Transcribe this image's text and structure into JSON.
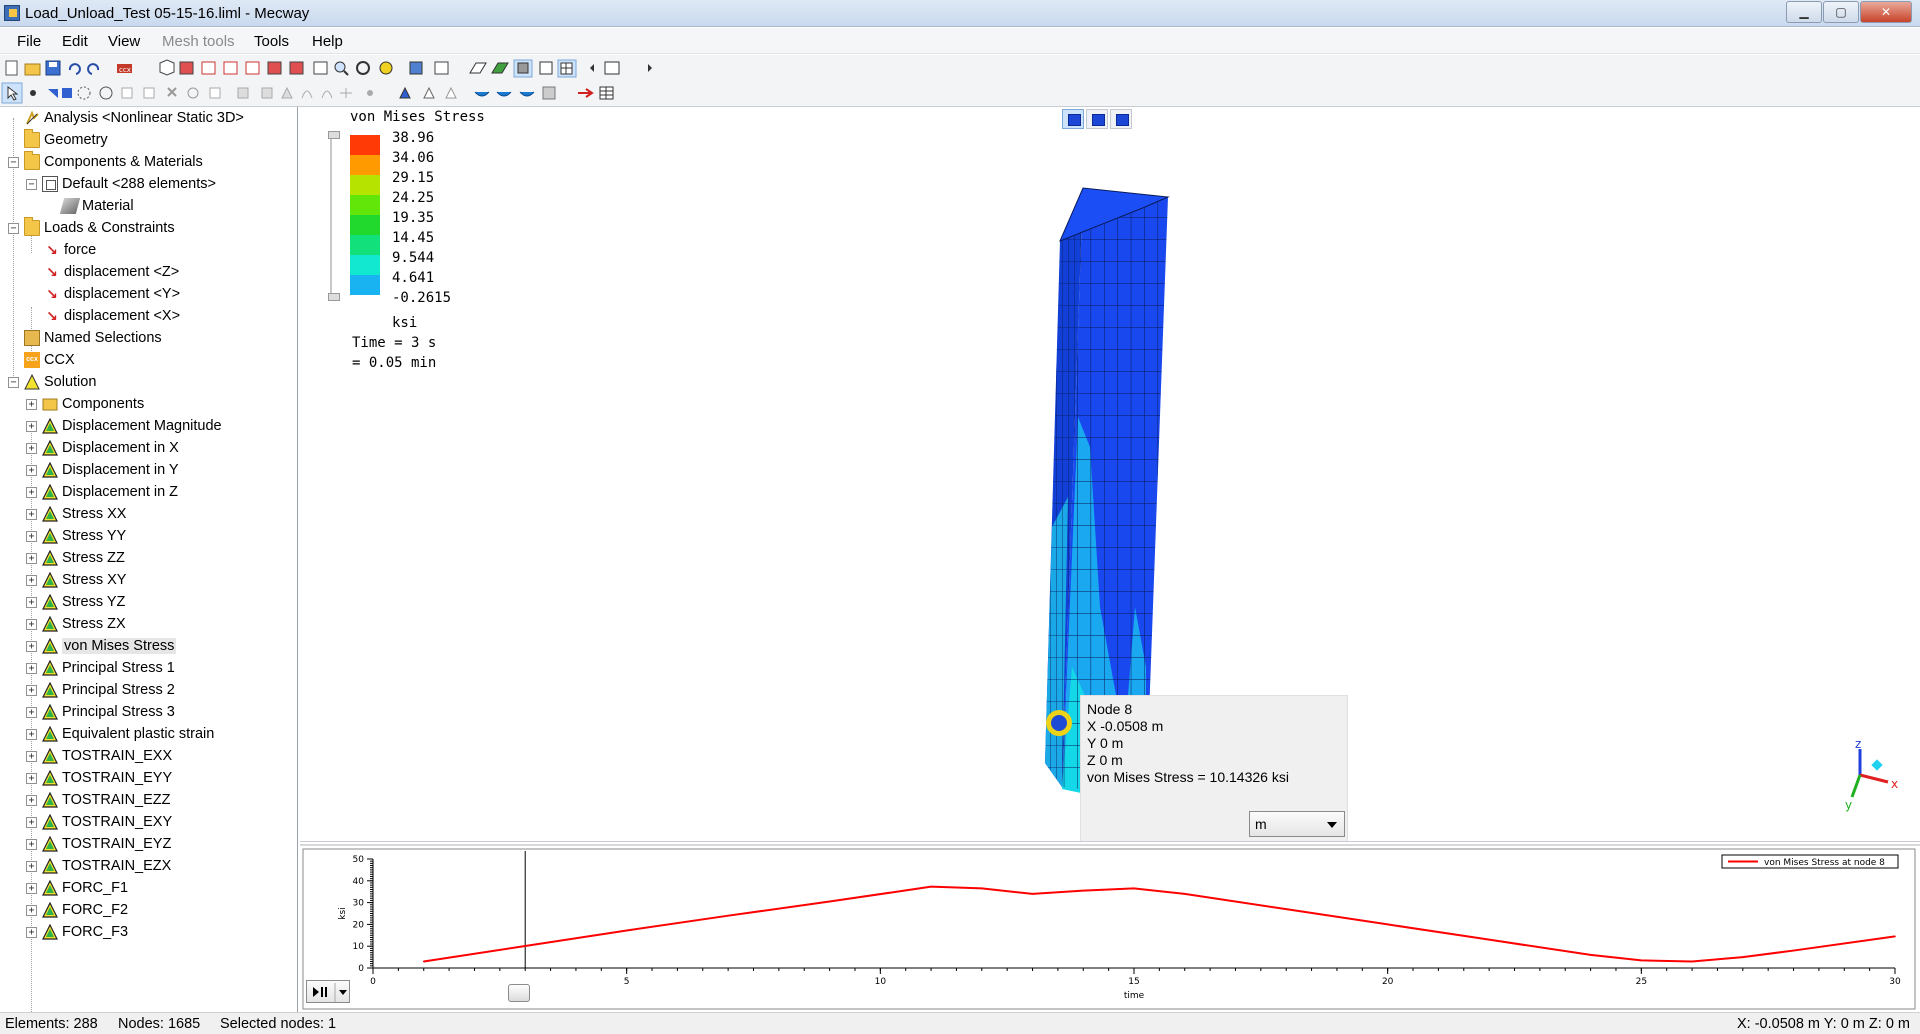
{
  "window": {
    "title": "Load_Unload_Test 05-15-16.liml - Mecway",
    "minimize": "▁",
    "maximize": "▢",
    "close": "✕"
  },
  "menu": [
    "File",
    "Edit",
    "View",
    "Mesh tools",
    "Tools",
    "Help"
  ],
  "menu_disabled": [
    "Mesh tools"
  ],
  "tree": {
    "items": [
      {
        "label": "Analysis <Nonlinear Static 3D>",
        "icon": "analysis-icon"
      },
      {
        "label": "Geometry",
        "icon": "folder-icon"
      },
      {
        "label": "Components & Materials",
        "icon": "components-icon"
      },
      {
        "label": "Default <288 elements>",
        "icon": "mesh-icon"
      },
      {
        "label": "Material",
        "icon": "material-icon"
      },
      {
        "label": "Loads & Constraints",
        "icon": "loads-icon"
      },
      {
        "label": "force",
        "icon": "force-icon"
      },
      {
        "label": "displacement <Z>",
        "icon": "displacement-icon"
      },
      {
        "label": "displacement <Y>",
        "icon": "displacement-icon"
      },
      {
        "label": "displacement <X>",
        "icon": "displacement-icon"
      },
      {
        "label": "Named Selections",
        "icon": "named-selection-icon"
      },
      {
        "label": "CCX",
        "icon": "ccx-icon"
      },
      {
        "label": "Solution",
        "icon": "solution-icon"
      },
      {
        "label": "Components",
        "icon": "components-icon"
      },
      {
        "label": "Displacement Magnitude",
        "icon": "result-icon"
      },
      {
        "label": "Displacement in X",
        "icon": "result-icon"
      },
      {
        "label": "Displacement in Y",
        "icon": "result-icon"
      },
      {
        "label": "Displacement in Z",
        "icon": "result-icon"
      },
      {
        "label": "Stress XX",
        "icon": "result-icon"
      },
      {
        "label": "Stress YY",
        "icon": "result-icon"
      },
      {
        "label": "Stress ZZ",
        "icon": "result-icon"
      },
      {
        "label": "Stress XY",
        "icon": "result-icon"
      },
      {
        "label": "Stress YZ",
        "icon": "result-icon"
      },
      {
        "label": "Stress ZX",
        "icon": "result-icon"
      },
      {
        "label": "von Mises Stress",
        "icon": "result-icon"
      },
      {
        "label": "Principal Stress 1",
        "icon": "result-icon"
      },
      {
        "label": "Principal Stress 2",
        "icon": "result-icon"
      },
      {
        "label": "Principal Stress 3",
        "icon": "result-icon"
      },
      {
        "label": "Equivalent plastic strain",
        "icon": "result-icon"
      },
      {
        "label": "TOSTRAIN_EXX",
        "icon": "result-icon"
      },
      {
        "label": "TOSTRAIN_EYY",
        "icon": "result-icon"
      },
      {
        "label": "TOSTRAIN_EZZ",
        "icon": "result-icon"
      },
      {
        "label": "TOSTRAIN_EXY",
        "icon": "result-icon"
      },
      {
        "label": "TOSTRAIN_EYZ",
        "icon": "result-icon"
      },
      {
        "label": "TOSTRAIN_EZX",
        "icon": "result-icon"
      },
      {
        "label": "FORC_F1",
        "icon": "result-icon"
      },
      {
        "label": "FORC_F2",
        "icon": "result-icon"
      },
      {
        "label": "FORC_F3",
        "icon": "result-icon"
      }
    ],
    "selected": "von Mises Stress"
  },
  "legend": {
    "title": "von Mises Stress",
    "values": [
      "38.96",
      "34.06",
      "29.15",
      "24.25",
      "19.35",
      "14.45",
      "9.544",
      "4.641",
      "-0.2615"
    ],
    "colors": [
      "#ff3a06",
      "#ff9a00",
      "#b6e400",
      "#62e60a",
      "#21d82c",
      "#12e07a",
      "#12e8cf",
      "#18b3f0",
      "#1140f2"
    ],
    "unit": "ksi",
    "time_line1": "Time = 3 s",
    "time_line2": "= 0.05 min"
  },
  "node_info": {
    "node": "Node  8",
    "x": "X  -0.0508 m",
    "y": "Y  0 m",
    "z": "Z  0 m",
    "result": "von Mises Stress = 10.14326 ksi",
    "unit_select": "m"
  },
  "axes_triad": {
    "x": "x",
    "y": "y",
    "z": "z"
  },
  "chart_data": {
    "type": "line",
    "title": "",
    "xlabel": "time",
    "ylabel": "ksi",
    "xlim": [
      0,
      30
    ],
    "ylim": [
      0,
      50
    ],
    "xticks": [
      0,
      5,
      10,
      15,
      20,
      25,
      30
    ],
    "yticks": [
      0,
      10,
      20,
      30,
      40,
      50
    ],
    "current_time": 3,
    "legend_position": "top-right",
    "series": [
      {
        "name": "von Mises Stress at node 8",
        "color": "#ff0000",
        "x": [
          1,
          3,
          5,
          7,
          9,
          11,
          12,
          13,
          14,
          15,
          16,
          18,
          20,
          22,
          24,
          25,
          26,
          27,
          28,
          30
        ],
        "y": [
          3.0,
          10.1,
          17.2,
          24.0,
          30.5,
          37.3,
          36.5,
          34.0,
          35.5,
          36.5,
          34.0,
          27.0,
          20.0,
          13.0,
          6.0,
          3.5,
          3.0,
          5.0,
          8.0,
          14.5
        ]
      }
    ]
  },
  "status": {
    "elements": "Elements: 288",
    "nodes": "Nodes: 1685",
    "selected": "Selected nodes: 1",
    "coords": "X: -0.0508 m Y: 0 m Z: 0 m"
  }
}
